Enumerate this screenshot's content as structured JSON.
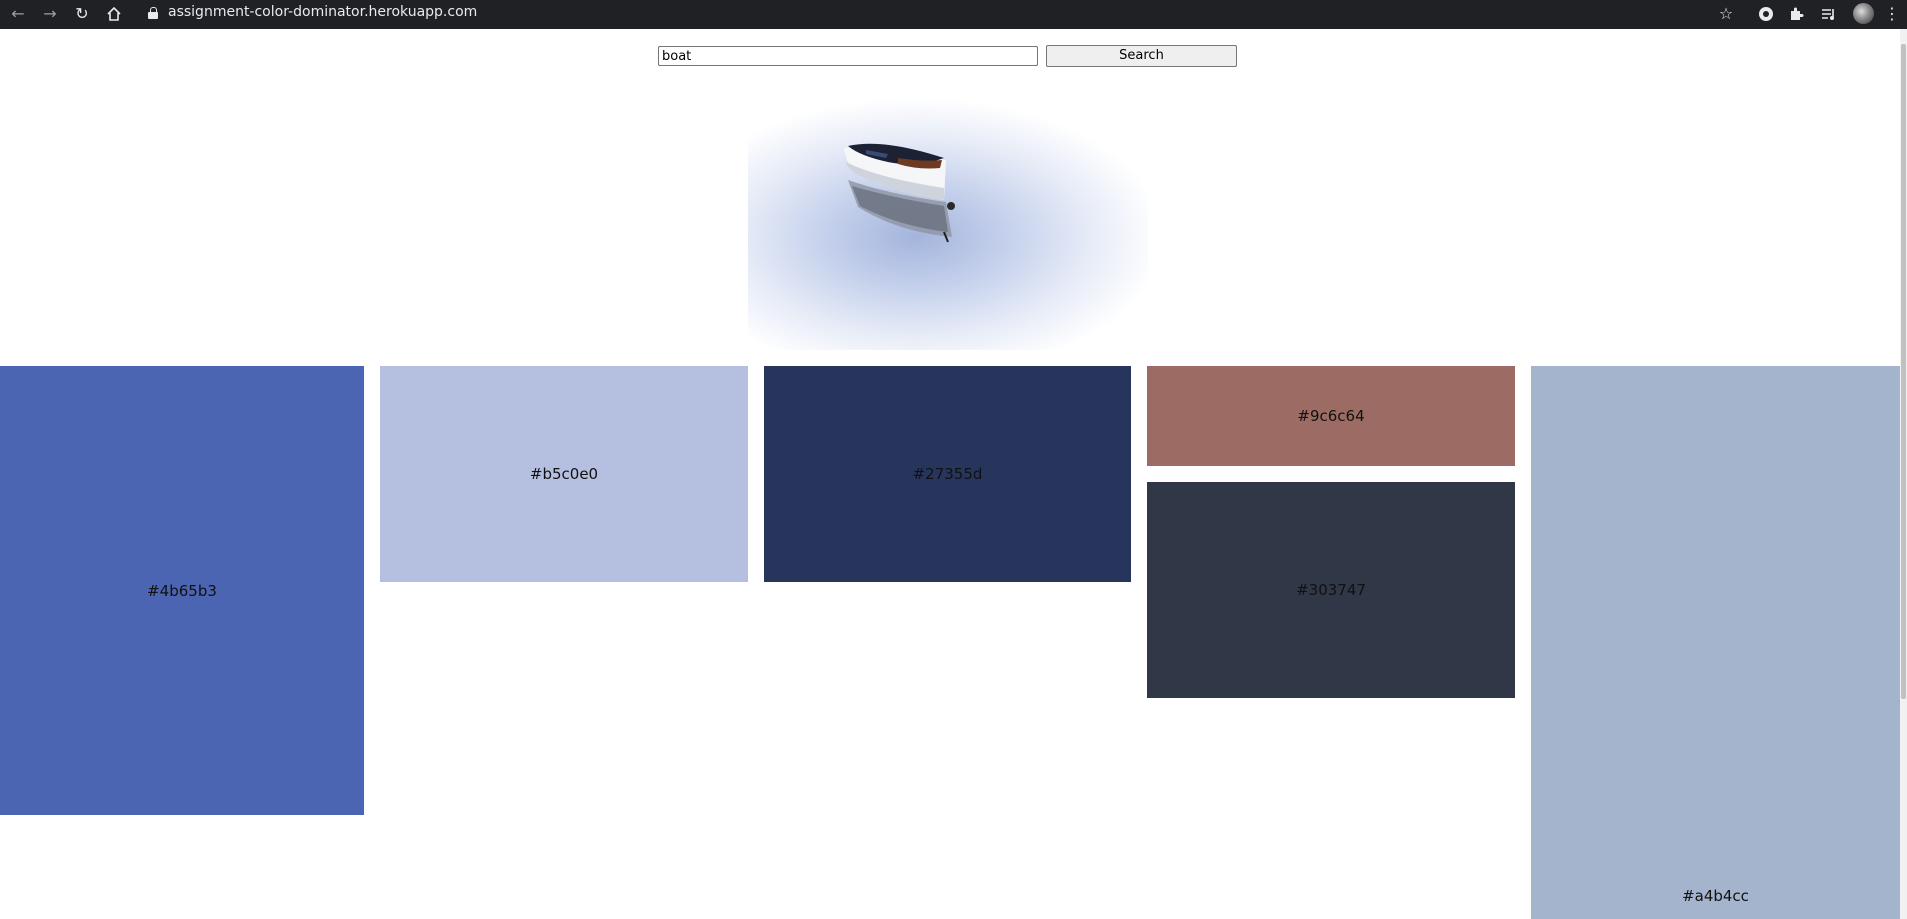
{
  "browser": {
    "url": "assignment-color-dominator.herokuapp.com",
    "icons": [
      "back-arrow-icon",
      "forward-arrow-icon",
      "reload-icon",
      "home-icon",
      "lock-icon",
      "star-icon",
      "account-icon",
      "extensions-icon",
      "media-control-icon",
      "avatar",
      "menu-dots-icon"
    ]
  },
  "search": {
    "value": "boat",
    "button_label": "Search"
  },
  "image": {
    "subject": "boat"
  },
  "swatches": [
    {
      "hex": "#4b65b3",
      "label": "#4b65b3"
    },
    {
      "hex": "#b5c0e0",
      "label": "#b5c0e0"
    },
    {
      "hex": "#27355d",
      "label": "#27355d"
    },
    {
      "hex": "#9c6c64",
      "label": "#9c6c64"
    },
    {
      "hex": "#303747",
      "label": "#303747"
    },
    {
      "hex": "#a4b4cc",
      "label": "#a4b4cc"
    }
  ]
}
